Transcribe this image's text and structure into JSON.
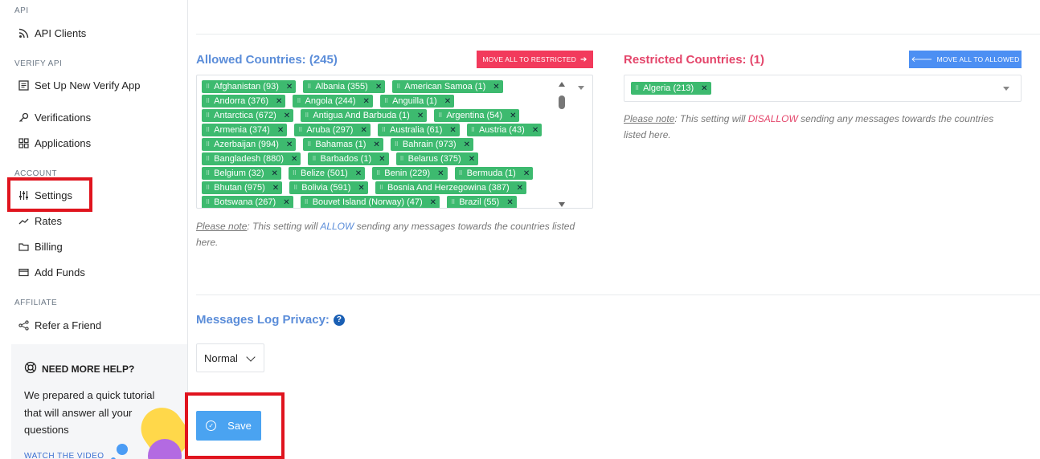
{
  "sidebar": {
    "sections": {
      "api": "API",
      "verify_api": "VERIFY API",
      "account": "ACCOUNT",
      "affiliate": "AFFILIATE"
    },
    "items": {
      "api_clients": "API Clients",
      "setup_verify": "Set Up New Verify App",
      "verifications": "Verifications",
      "applications": "Applications",
      "settings": "Settings",
      "rates": "Rates",
      "billing": "Billing",
      "add_funds": "Add Funds",
      "refer": "Refer a Friend"
    },
    "help": {
      "title": "NEED MORE HELP?",
      "text": "We prepared a quick tutorial that will answer all your questions",
      "link": "WATCH THE VIDEO"
    }
  },
  "allowed": {
    "title": "Allowed Countries: (245)",
    "move_button": "MOVE ALL TO RESTRICTED",
    "tags": [
      "Afghanistan (93)",
      "Albania (355)",
      "American Samoa (1)",
      "Andorra (376)",
      "Angola (244)",
      "Anguilla (1)",
      "Antarctica (672)",
      "Antigua And Barbuda (1)",
      "Argentina (54)",
      "Armenia (374)",
      "Aruba (297)",
      "Australia (61)",
      "Austria (43)",
      "Azerbaijan (994)",
      "Bahamas (1)",
      "Bahrain (973)",
      "Bangladesh (880)",
      "Barbados (1)",
      "Belarus (375)",
      "Belgium (32)",
      "Belize (501)",
      "Benin (229)",
      "Bermuda (1)",
      "Bhutan (975)",
      "Bolivia (591)",
      "Bosnia And Herzegowina (387)",
      "Botswana (267)",
      "Bouvet Island (Norway) (47)",
      "Brazil (55)"
    ],
    "note_label": "Please note",
    "note_pre": ": This setting will ",
    "note_kw": "ALLOW",
    "note_post": " sending any messages towards the countries listed here."
  },
  "restricted": {
    "title": "Restricted Countries: (1)",
    "move_button": "MOVE ALL TO ALLOWED",
    "tags": [
      "Algeria (213)"
    ],
    "note_label": "Please note",
    "note_pre": ": This setting will ",
    "note_kw": "DISALLOW",
    "note_post": " sending any messages towards the countries listed here."
  },
  "privacy": {
    "title": "Messages Log Privacy:",
    "selected": "Normal"
  },
  "save_label": "Save",
  "colors": {
    "tag": "#3dba6f",
    "allowed_heading": "#5b8dd9",
    "restricted_heading": "#e4466b",
    "move_restricted": "#f23a5c",
    "move_allowed": "#4c8ff3",
    "save": "#4aa3f1",
    "highlight": "#e0141e"
  }
}
